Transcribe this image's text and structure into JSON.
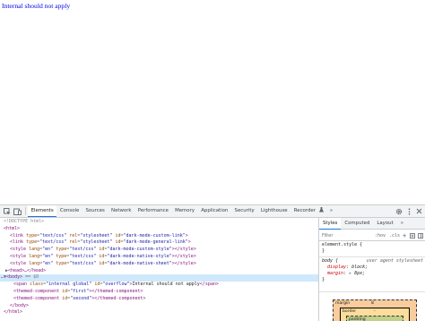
{
  "page": {
    "text": "Internal should not apply"
  },
  "devtools": {
    "tabs": [
      "Elements",
      "Console",
      "Sources",
      "Network",
      "Performance",
      "Memory",
      "Application",
      "Security",
      "Lighthouse",
      "Recorder"
    ],
    "active_tab": "Elements",
    "more_tabs_label": "»",
    "icons": [
      "inspect-icon",
      "device-toolbar-icon",
      "recorder-flask-icon",
      "settings-gear-icon",
      "more-menu-icon",
      "close-icon"
    ],
    "colors": {
      "accent": "#1a73e8",
      "tag": "#881280",
      "attribute": "#994500",
      "value": "#1a1aa6",
      "selection": "#cfe8fc"
    }
  },
  "dom": {
    "doctype": "<!DOCTYPE html>",
    "html_open": "<html>",
    "links": [
      {
        "rel_type": "text/css",
        "rel": "stylesheet",
        "id": "dark-mode-custom-link"
      },
      {
        "rel_type": "text/css",
        "rel": "stylesheet",
        "id": "dark-mode-general-link"
      }
    ],
    "styles": [
      {
        "lang": "en",
        "type": "text/css",
        "id": "dark-mode-custom-style"
      },
      {
        "lang": "en",
        "type": "text/css",
        "id": "dark-mode-native-style"
      },
      {
        "lang": "en",
        "type": "text/css",
        "id": "dark-mode-native-sheet"
      }
    ],
    "head_collapsed": "<head>…</head>",
    "body_open": "<body>",
    "body_marker": "== $0",
    "span": {
      "class": "internal global",
      "id": "overflow",
      "text": "Internal should not apply"
    },
    "themed": [
      {
        "id": "first"
      },
      {
        "id": "second"
      }
    ],
    "body_close": "</body>",
    "html_close": "</html>"
  },
  "sidebar": {
    "tabs": [
      "Styles",
      "Computed",
      "Layout"
    ],
    "active_tab": "Styles",
    "more_label": "»",
    "filter_placeholder": "Filter",
    "filter_hov": ":hov",
    "filter_cls": ".cls",
    "filter_plus": "+",
    "element_style_selector": "element.style {",
    "element_style_close": "}",
    "body_rule": {
      "selector": "body {",
      "source": "user agent stylesheet",
      "props": [
        {
          "name": "display",
          "value": "block;"
        },
        {
          "name": "margin",
          "value": "8px;"
        }
      ],
      "close": "}"
    },
    "box_model": {
      "margin_label": "margin",
      "margin_value": "8",
      "border_label": "border",
      "border_value": "-",
      "padding_label": "padding",
      "padding_value": "-"
    }
  }
}
